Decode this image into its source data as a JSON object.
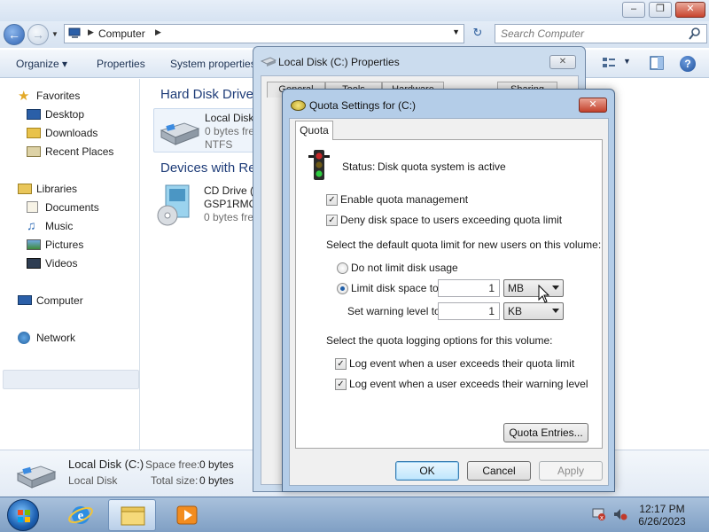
{
  "explorer": {
    "address": {
      "crumb": "Computer"
    },
    "search": {
      "placeholder": "Search Computer"
    },
    "toolbar": {
      "organize": "Organize",
      "properties": "Properties",
      "system_properties": "System properties"
    },
    "nav": {
      "favorites": "Favorites",
      "desktop": "Desktop",
      "downloads": "Downloads",
      "recent_places": "Recent Places",
      "libraries": "Libraries",
      "documents": "Documents",
      "music": "Music",
      "pictures": "Pictures",
      "videos": "Videos",
      "computer": "Computer",
      "network": "Network"
    },
    "groups": {
      "hard_disk": "Hard Disk Drive",
      "devices": "Devices with Re"
    },
    "local_disk_tile": {
      "name": "Local Disk",
      "free": "0 bytes fre",
      "fs": "NTFS"
    },
    "cd_tile": {
      "name": "CD Drive (",
      "label": "GSP1RMC",
      "free": "0 bytes fre"
    },
    "details": {
      "name": "Local Disk (C:)",
      "type": "Local Disk",
      "space_free_label": "Space free:",
      "space_free_value": "0 bytes",
      "total_size_label": "Total size:",
      "total_size_value": "0 bytes"
    }
  },
  "properties_window": {
    "title": "Local Disk (C:) Properties",
    "tabs": [
      "General",
      "Tools",
      "Hardware",
      "Sharing"
    ]
  },
  "quota_dialog": {
    "title": "Quota Settings for  (C:)",
    "tab": "Quota",
    "status_label": "Status:",
    "status_value": "Disk quota system is active",
    "enable_quota": "Enable quota management",
    "deny_space": "Deny disk space to users exceeding quota limit",
    "default_limit_heading": "Select the default quota limit for new users on this volume:",
    "do_not_limit": "Do not limit disk usage",
    "limit_to": "Limit disk space to",
    "limit_value": "1",
    "limit_unit": "MB",
    "warning_label": "Set warning level to",
    "warning_value": "1",
    "warning_unit": "KB",
    "logging_heading": "Select the quota logging options for this volume:",
    "log_limit": "Log event when a user exceeds their quota limit",
    "log_warning": "Log event when a user exceeds their warning level",
    "quota_entries": "Quota Entries...",
    "ok": "OK",
    "cancel": "Cancel",
    "apply": "Apply",
    "checked": {
      "enable_quota": true,
      "deny_space": true,
      "log_limit": true,
      "log_warning": true
    },
    "selected_radio": "limit_to"
  },
  "taskbar": {
    "time": "12:17 PM",
    "date": "6/26/2023"
  },
  "colors": {
    "accent": "#1f5ea8",
    "close_red": "#c3412c",
    "taskbar": "#7f9fc4"
  }
}
